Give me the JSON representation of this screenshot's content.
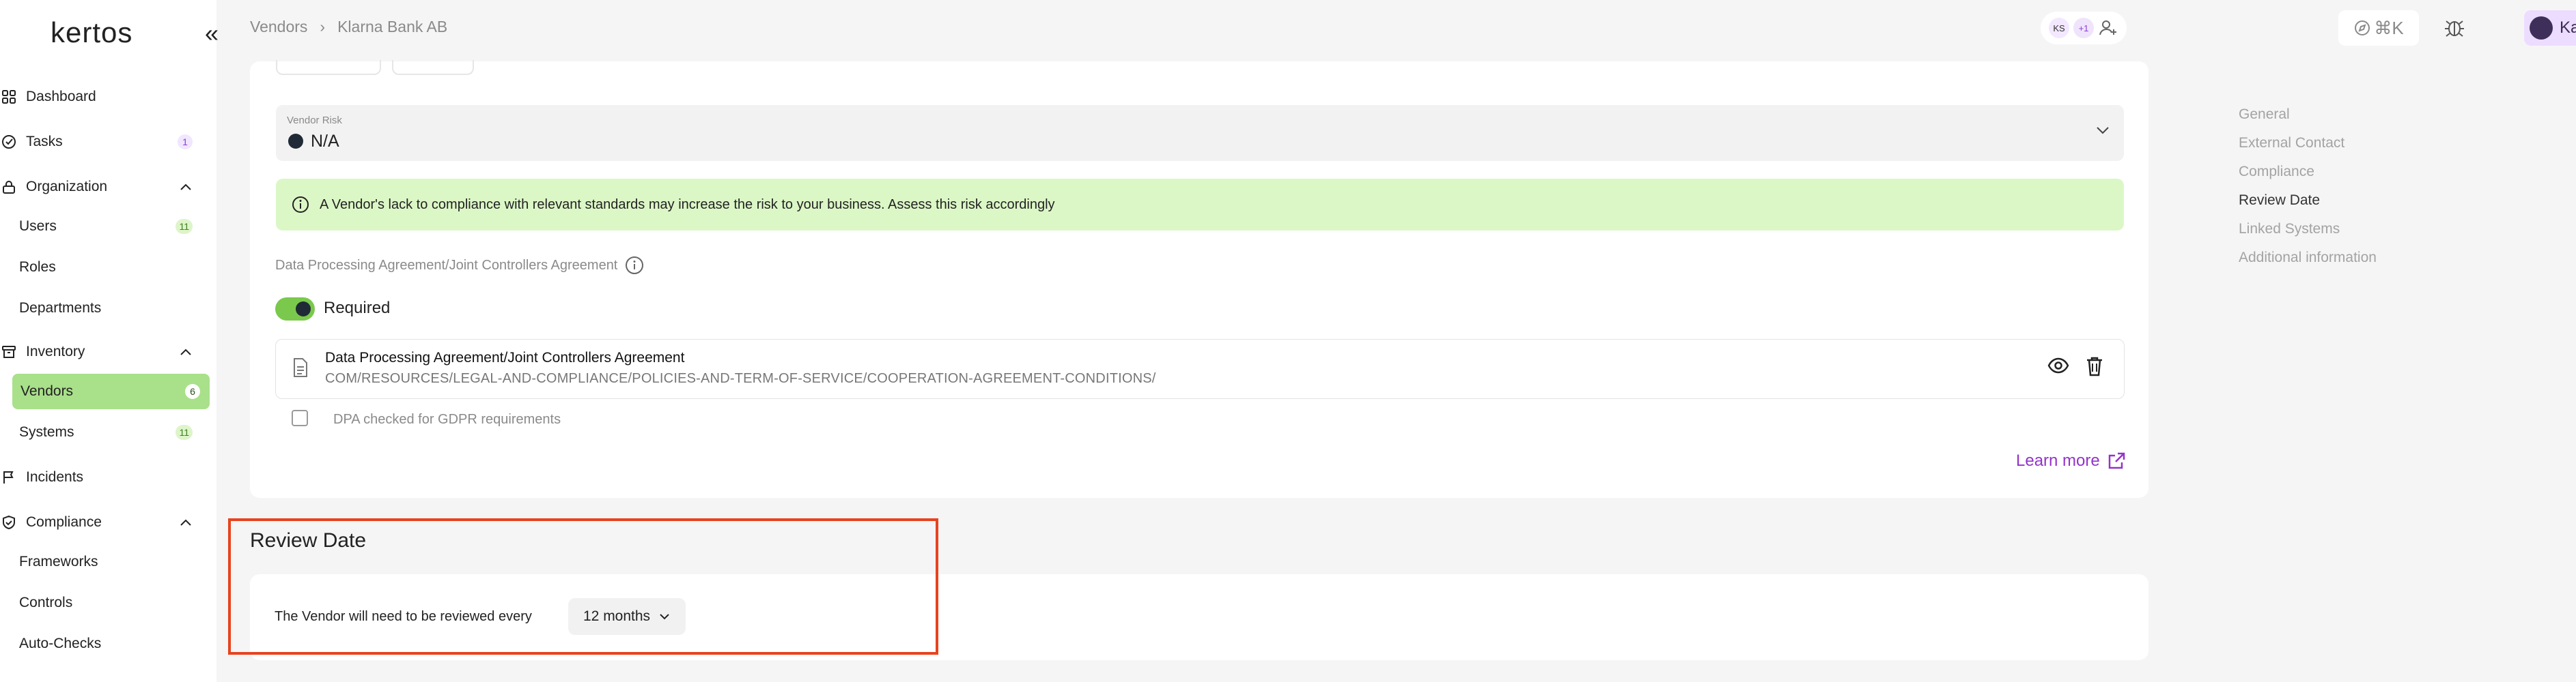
{
  "app": {
    "logo_text": "kertos"
  },
  "sidebar": {
    "items": [
      {
        "label": "Dashboard",
        "icon": "grid-icon"
      },
      {
        "label": "Tasks",
        "icon": "check-circle-icon",
        "badge": "1"
      },
      {
        "label": "Organization",
        "icon": "lock-icon",
        "expanded": true
      },
      {
        "label": "Users",
        "badge": "11"
      },
      {
        "label": "Roles"
      },
      {
        "label": "Departments"
      },
      {
        "label": "Inventory",
        "icon": "archive-icon",
        "expanded": true
      },
      {
        "label": "Vendors",
        "badge": "6",
        "active": true
      },
      {
        "label": "Systems",
        "badge": "11"
      },
      {
        "label": "Incidents",
        "icon": "flag-icon"
      },
      {
        "label": "Compliance",
        "icon": "shield-icon",
        "expanded": true
      },
      {
        "label": "Frameworks"
      },
      {
        "label": "Controls"
      },
      {
        "label": "Auto-Checks"
      }
    ]
  },
  "header": {
    "breadcrumb": [
      "Vendors",
      "Klarna Bank AB"
    ],
    "avatars": [
      "KS",
      "+1"
    ],
    "command_shortcut": "⌘K",
    "user_name": "Kaia"
  },
  "vendor_risk": {
    "label": "Vendor Risk",
    "value": "N/A",
    "dot_color": "#1f2a36"
  },
  "info_banner": "A Vendor's lack to compliance with relevant standards may increase the risk to your business. Assess this risk accordingly",
  "dpa": {
    "heading": "Data Processing Agreement/Joint Controllers Agreement",
    "toggle_label": "Required",
    "toggle_on": true,
    "file_title": "Data Processing Agreement/Joint Controllers Agreement",
    "file_path": "COM/RESOURCES/LEGAL-AND-COMPLIANCE/POLICIES-AND-TERM-OF-SERVICE/COOPERATION-AGREEMENT-CONDITIONS/",
    "checkbox_label": "DPA checked for GDPR requirements",
    "checkbox_checked": false,
    "learn_more": "Learn more"
  },
  "review": {
    "title": "Review Date",
    "text": "The Vendor will need to be reviewed every",
    "interval": "12 months"
  },
  "toc": [
    "General",
    "External Contact",
    "Compliance",
    "Review Date",
    "Linked Systems",
    "Additional information"
  ],
  "toc_active": "Review Date",
  "colors": {
    "accent_green": "#a9e08a",
    "banner_green": "#dcf7c6",
    "link_purple": "#9333c9",
    "highlight_red": "#e8431f"
  }
}
